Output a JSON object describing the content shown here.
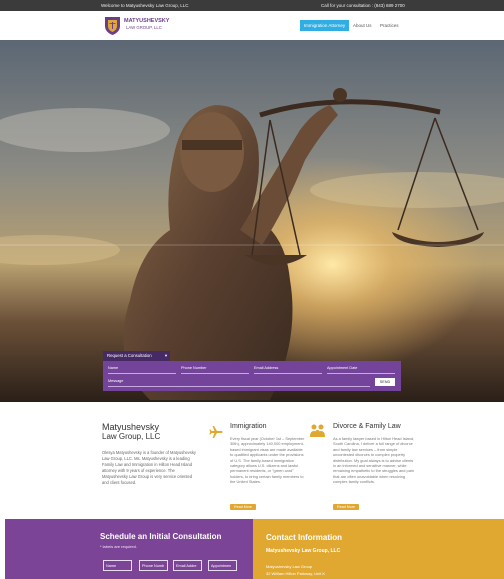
{
  "topbar": {
    "welcome": "Welcome to Matyushevsky Law Group, LLC",
    "consult": "Call for your consultation : (843) 689 2700"
  },
  "logo": {
    "name_line1": "MATYUSHEVSKY",
    "name_line2": "LAW GROUP, LLC"
  },
  "nav": {
    "items": [
      "Immigration Attorney",
      "About Us",
      "Practices"
    ]
  },
  "consult_form": {
    "tab_label": "Request a Consultation",
    "caret": "▾",
    "name_placeholder": "Name",
    "phone_placeholder": "Phone Number",
    "email_placeholder": "Email Address",
    "date_placeholder": "Appointment Date",
    "message_placeholder": "Message",
    "send_label": "SEND"
  },
  "about": {
    "title": "Matyushevsky",
    "subtitle": "Law Group, LLC",
    "text": "Olesya Matyushevsky is a founder of Matyushevsky Law Group, LLC. Ms. Matyushevsky is a leading Family Law and Immigration in Hilton Head Island attorney with 9 years of experience. The Matyushevsky Law Group is very service oriented and client focused."
  },
  "services": [
    {
      "title": "Immigration",
      "text": "Every fiscal year (October 1st – September 30th), approximately 140,000 employment-based immigrant visas are made available to qualified applicants under the provisions of U.S. The family-based immigration category allows U.S. citizens and lawful permanent residents, or \"green card\" holders, to bring certain family members to the United States.",
      "button": "Read More",
      "icon": "airplane-icon",
      "icon_color": "#e0a830"
    },
    {
      "title": "Divorce & Family Law",
      "text": "As a family lawyer based in Hilton Head Island, South Carolina, I deliver a full range of divorce and family law services – from simple uncontested divorces to complex property distribution. My goal always is to advise clients in an informed and sensitive manner, while remaining empathetic to the struggles and pain that are often unavoidable when resolving complex family conflicts.",
      "button": "Read More",
      "icon": "family-icon",
      "icon_color": "#e0a830"
    }
  ],
  "schedule": {
    "title": "Schedule an Initial Consultation",
    "required_note": "* labels are required.",
    "fields": [
      "Name",
      "Phone Numb",
      "Email Addre",
      "Appointmen"
    ]
  },
  "contact": {
    "title": "Contact Information",
    "firm": "Matyushevsky Law Group, LLC",
    "address_line1": "Matyushevsky Law Group",
    "address_line2": "32 William Hilton Parkway, Unit K"
  },
  "colors": {
    "purple": "#74449b",
    "dark_purple": "#462a63",
    "gold": "#e0a830",
    "nav_blue": "#30aee3",
    "topbar": "#3b3b3b"
  }
}
